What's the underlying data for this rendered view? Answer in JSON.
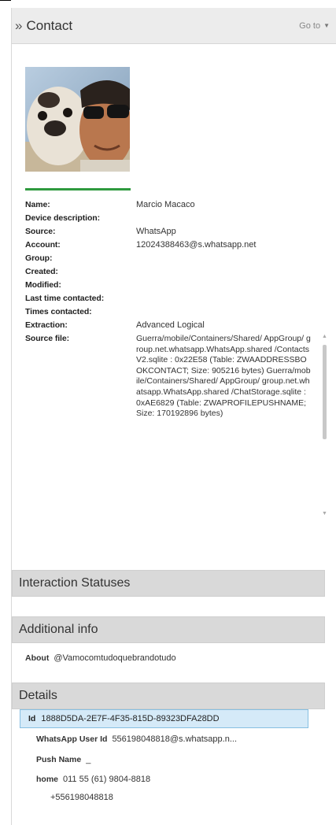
{
  "header": {
    "title": "Contact",
    "chevron_icon": "double-chevron-right-icon",
    "goto_label": "Go to",
    "goto_icon": "caret-down-icon"
  },
  "avatar": {
    "description": "contact photo"
  },
  "properties": [
    {
      "label": "Name:",
      "value": "Marcio Macaco"
    },
    {
      "label": "Device description:",
      "value": ""
    },
    {
      "label": "Source:",
      "value": "WhatsApp"
    },
    {
      "label": "Account:",
      "value": "12024388463@s.whatsapp.net"
    },
    {
      "label": "Group:",
      "value": ""
    },
    {
      "label": "Created:",
      "value": ""
    },
    {
      "label": "Modified:",
      "value": ""
    },
    {
      "label": "Last time contacted:",
      "value": ""
    },
    {
      "label": "Times contacted:",
      "value": ""
    },
    {
      "label": "Extraction:",
      "value": "Advanced Logical"
    }
  ],
  "source_file": {
    "label": "Source file:",
    "value": "Guerra/mobile/Containers/Shared/ AppGroup/ group.net.whatsapp.WhatsApp.shared /ContactsV2.sqlite : 0x22E58 (Table: ZWAADDRESSBOOKCONTACT; Size: 905216 bytes) Guerra/mobile/Containers/Shared/ AppGroup/ group.net.whatsapp.WhatsApp.shared /ChatStorage.sqlite : 0xAE6829 (Table: ZWAPROFILEPUSHNAME; Size: 170192896 bytes)"
  },
  "sections": {
    "interaction": "Interaction Statuses",
    "additional": "Additional info",
    "details": "Details"
  },
  "additional_info": {
    "about_label": "About",
    "about_value": "@Vamocomtudoquebrandotudo"
  },
  "details": {
    "id_label": "Id",
    "id_value": "1888D5DA-2E7F-4F35-815D-89323DFA28DD",
    "wa_user_label": "WhatsApp User Id",
    "wa_user_value": "556198048818@s.whatsapp.n...",
    "push_label": "Push Name",
    "push_value": "_",
    "home_label": "home",
    "home_value": "011 55 (61) 9804-8818",
    "phone2_value": "+556198048818"
  },
  "colors": {
    "accent_green": "#2f9a3f",
    "selection": "#d5eaf8",
    "section_bg": "#d9d9d9"
  }
}
